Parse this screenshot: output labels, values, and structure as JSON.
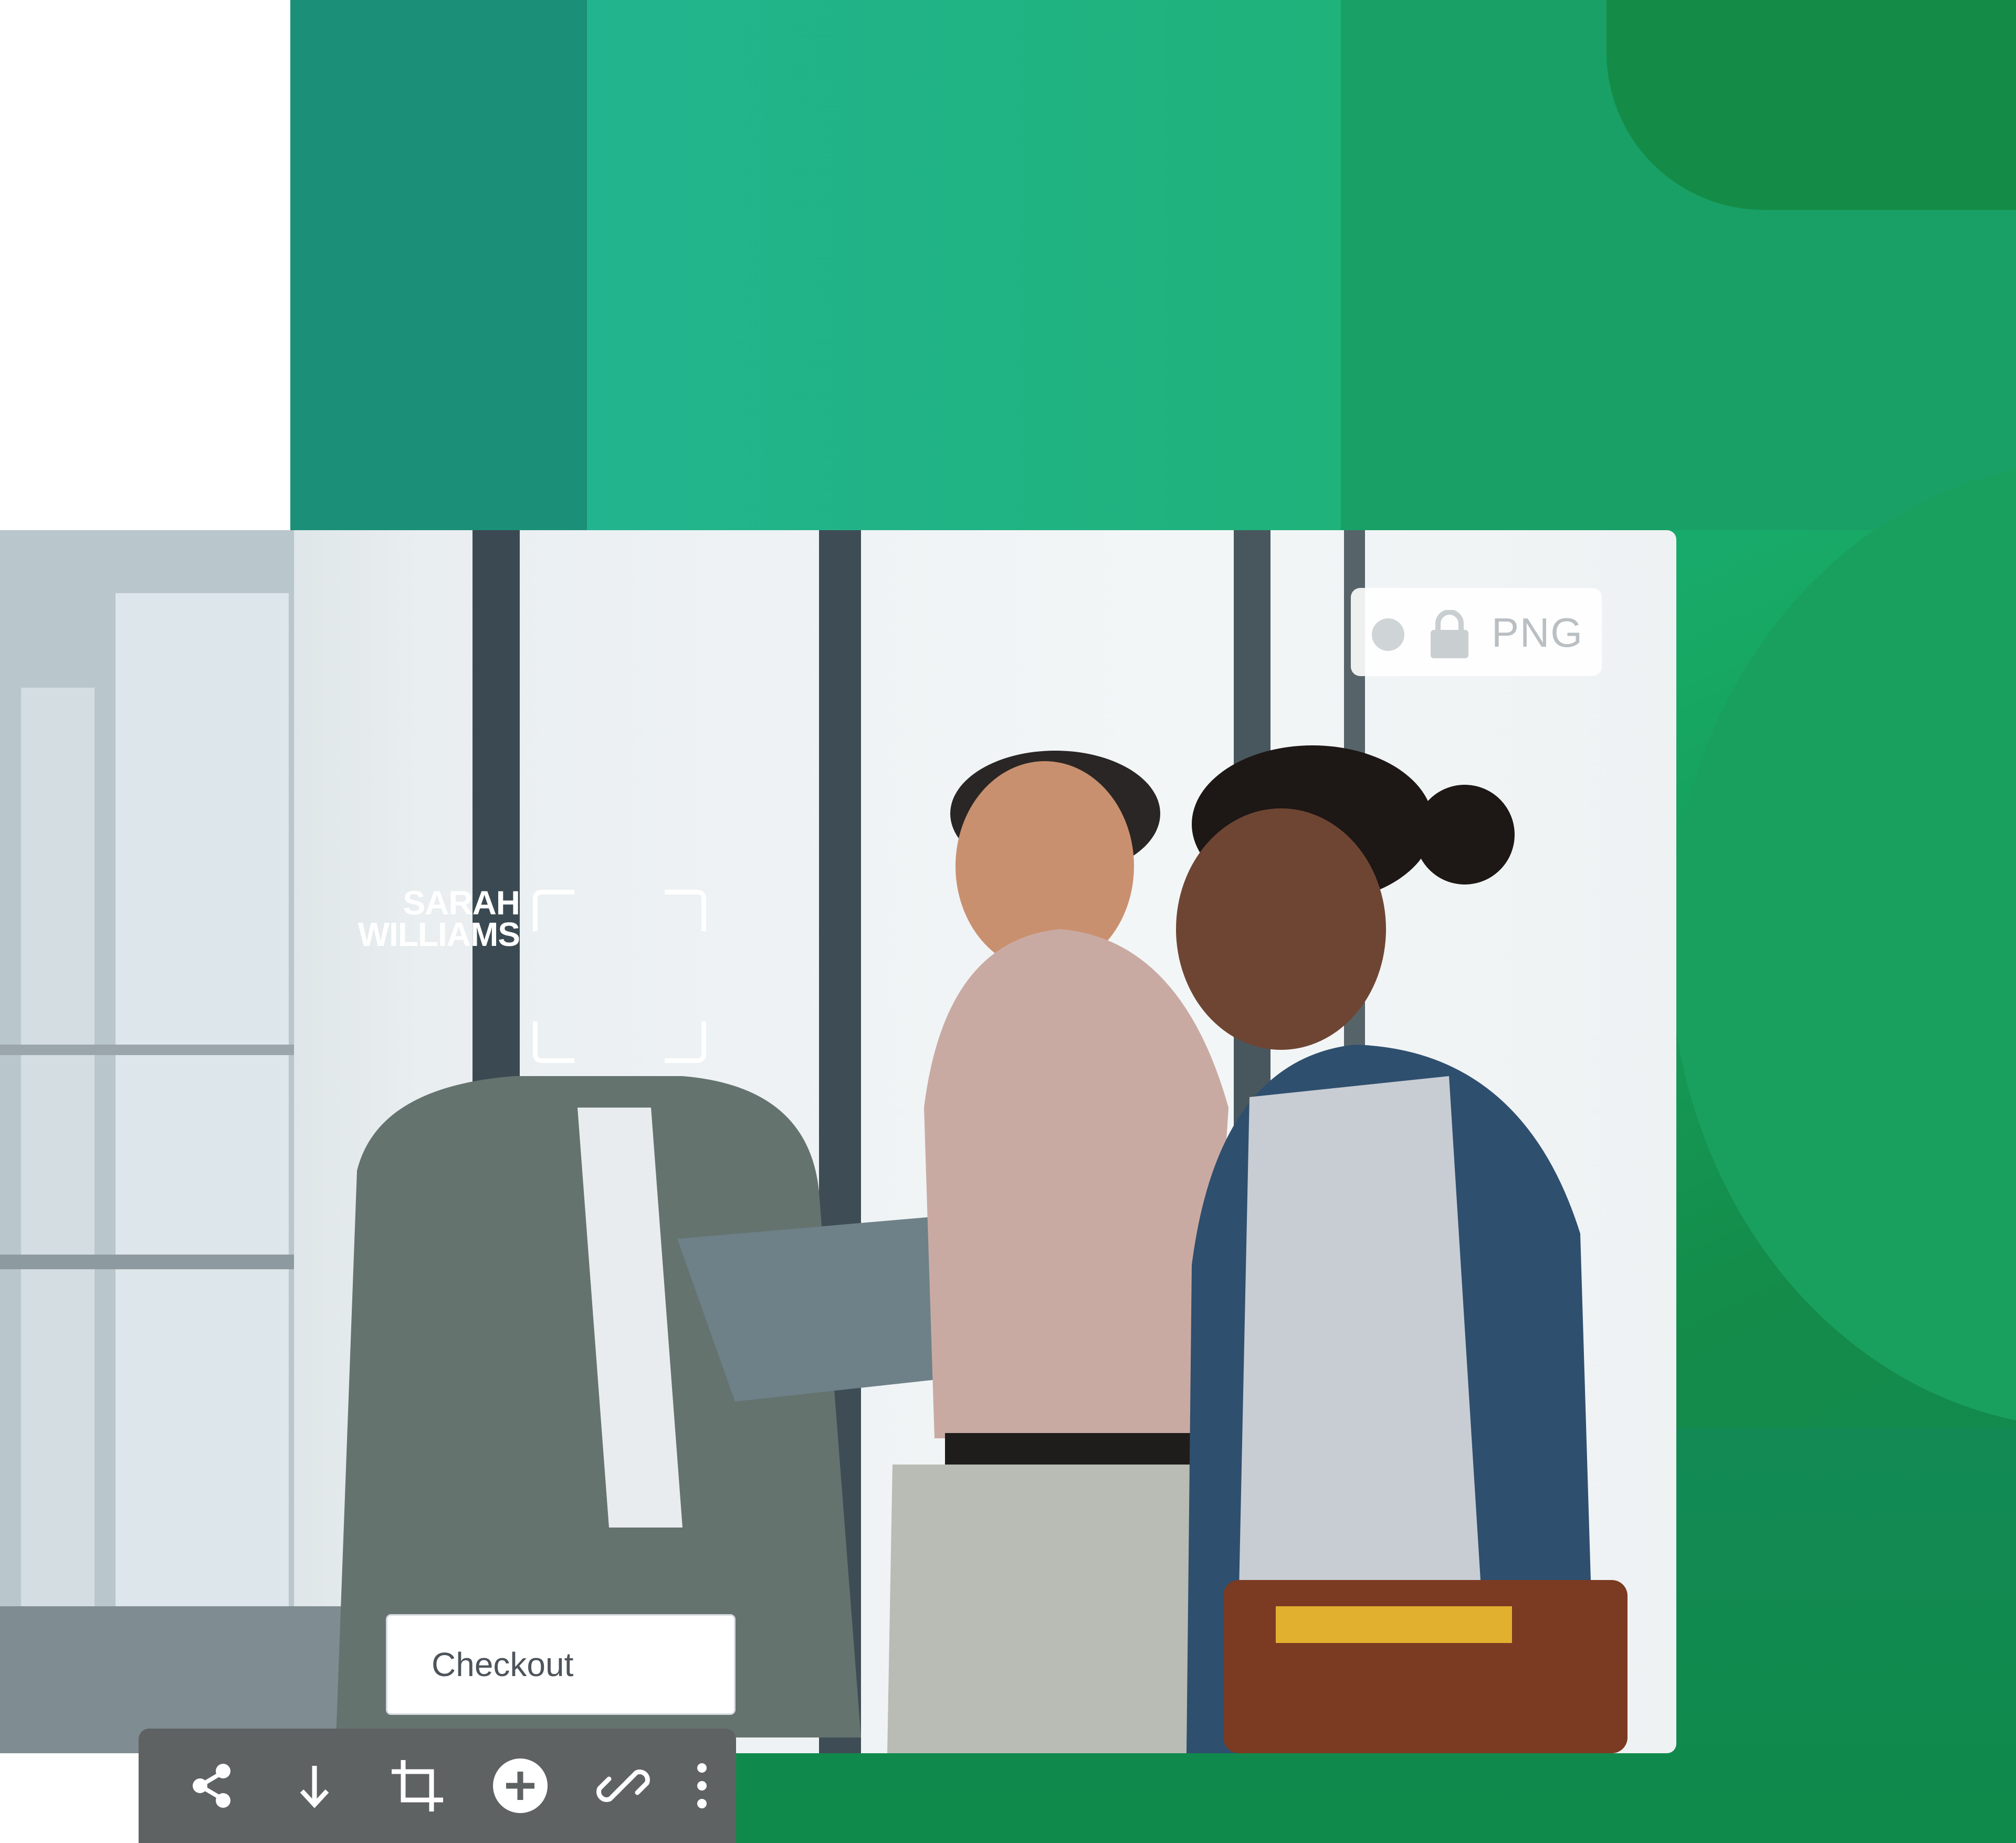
{
  "face_tag": {
    "line1": "SARAH",
    "line2": "WILLIAMS"
  },
  "format_badge": {
    "status": "inactive",
    "lock_icon": "lock-icon",
    "format": "PNG"
  },
  "checkout_label": "Checkout",
  "toolbar": {
    "icons": [
      "share-icon",
      "download-icon",
      "crop-icon",
      "add-icon",
      "link-icon",
      "more-vertical-icon"
    ]
  },
  "colors": {
    "bg_green": "#1DB386",
    "dark_green": "#148C47",
    "toolbar_bg": "#5F6263",
    "badge_text": "#B9BFC3"
  }
}
